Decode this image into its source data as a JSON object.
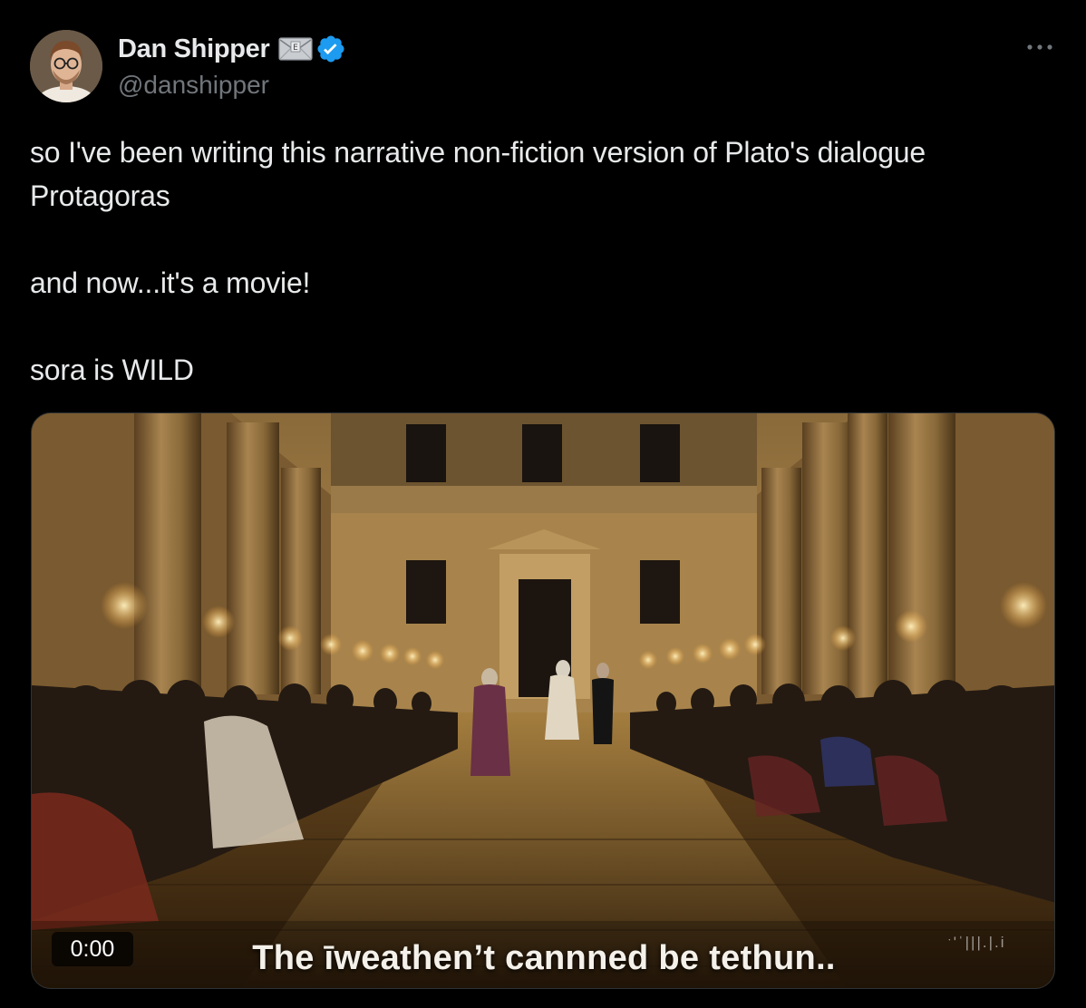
{
  "author": {
    "display_name": "Dan Shipper",
    "handle": "@danshipper",
    "avatar_icon": "user-avatar",
    "mail_badge_icon": "envelope-icon",
    "mail_badge_letter": "E",
    "verified_icon": "verified-check-icon",
    "verified_color": "#1d9bf0"
  },
  "more_icon": "more-horizontal-icon",
  "tweet": {
    "paragraphs": [
      "so I've been writing this narrative non-fiction version of Plato's dialogue Protagoras",
      "and now...it's a movie!",
      "sora is WILD"
    ]
  },
  "video": {
    "timestamp": "0:00",
    "caption": "The īweathen’t cannned be tethun..",
    "watermark": "ˑ'ˈ|||.|.i",
    "scene": "candlelit-hall"
  },
  "colors": {
    "background": "#000000",
    "text_primary": "#e7e9ea",
    "text_secondary": "#71767b",
    "accent": "#1d9bf0"
  }
}
